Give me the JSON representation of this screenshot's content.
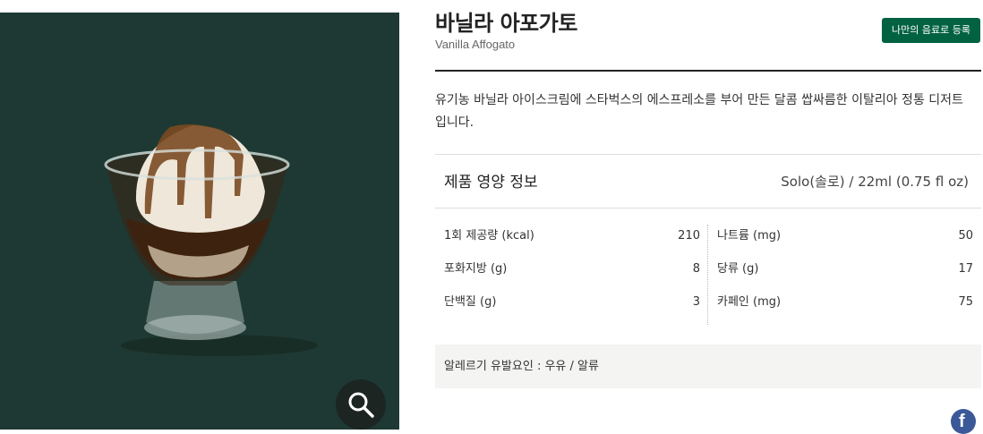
{
  "product": {
    "title": "바닐라 아포가토",
    "subtitle": "Vanilla Affogato",
    "favorite_label": "나만의 음료로 등록",
    "description": "유기농 바닐라 아이스크림에 스타벅스의 에스프레소를 부어 만든 달콤 쌉싸름한 이탈리아 정통 디저트입니다.",
    "image_icon": "affogato-image",
    "zoom_icon": "magnifier-icon"
  },
  "nutrition": {
    "heading": "제품 영양 정보",
    "serving": "Solo(솔로) / 22ml (0.75 fl oz)",
    "left": [
      {
        "label": "1회 제공량 (kcal)",
        "value": "210"
      },
      {
        "label": "포화지방 (g)",
        "value": "8"
      },
      {
        "label": "단백질 (g)",
        "value": "3"
      }
    ],
    "right": [
      {
        "label": "나트륨 (mg)",
        "value": "50"
      },
      {
        "label": "당류 (g)",
        "value": "17"
      },
      {
        "label": "카페인 (mg)",
        "value": "75"
      }
    ]
  },
  "allergy": {
    "text": "알레르기 유발요인 : 우유 / 알류"
  },
  "share": {
    "facebook_glyph": "f"
  },
  "colors": {
    "brand_green": "#006241",
    "image_background": "#1e3933"
  }
}
